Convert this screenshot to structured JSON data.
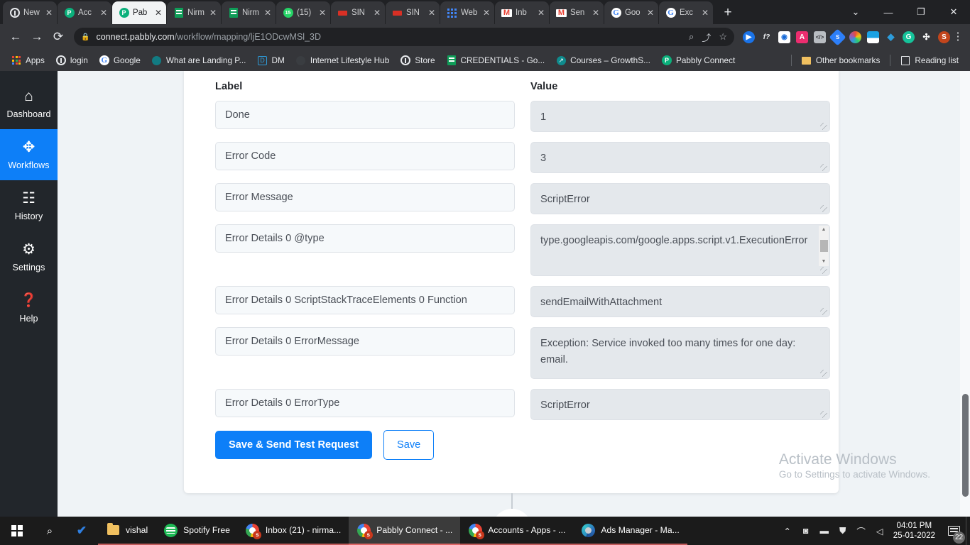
{
  "browser": {
    "tabs": [
      {
        "label": "New",
        "icon": "chrome-ring-icon",
        "active": false
      },
      {
        "label": "Acc",
        "icon": "pabbly-icon",
        "active": false
      },
      {
        "label": "Pab",
        "icon": "pabbly-icon",
        "active": true
      },
      {
        "label": "Nirm",
        "icon": "sheets-icon",
        "active": false
      },
      {
        "label": "Nirm",
        "icon": "sheets-icon",
        "active": false
      },
      {
        "label": "(15)",
        "icon": "whatsapp-icon",
        "active": false
      },
      {
        "label": "SIN",
        "icon": "red-icon",
        "active": false
      },
      {
        "label": "SIN",
        "icon": "red-icon",
        "active": false
      },
      {
        "label": "Web",
        "icon": "grid-icon",
        "active": false
      },
      {
        "label": "Inb",
        "icon": "gmail-icon",
        "active": false
      },
      {
        "label": "Sen",
        "icon": "gmail-icon",
        "active": false
      },
      {
        "label": "Goo",
        "icon": "google-icon",
        "active": false
      },
      {
        "label": "Exc",
        "icon": "google-icon",
        "active": false
      }
    ],
    "new_tab_label": "+",
    "tab_close_label": "✕",
    "window_controls": {
      "minimize_tabs": "⌄",
      "minimize": "—",
      "maximize": "❐",
      "close": "✕"
    },
    "nav": {
      "back": "←",
      "forward": "→",
      "reload": "⟳"
    },
    "address": {
      "lock_icon": "lock-icon",
      "domain": "connect.pabbly.com",
      "path": "/workflow/mapping/ljE1ODcwMSl_3D",
      "full_url": "connect.pabbly.com/workflow/mapping/ljE1ODcwMSl_3D"
    },
    "omni_actions": [
      {
        "name": "zoom-icon",
        "glyph": "⌕"
      },
      {
        "name": "share-icon",
        "glyph": "⤴"
      },
      {
        "name": "bookmark-star-icon",
        "glyph": "☆"
      }
    ],
    "extensions": [
      {
        "name": "loom-extension-icon",
        "glyph": "▶",
        "color": "#1a73e8"
      },
      {
        "name": "fonts-extension-icon",
        "glyph": "f?",
        "color": "#35363a"
      },
      {
        "name": "screen-recorder-extension-icon",
        "glyph": "◉",
        "color": "#1669d6"
      },
      {
        "name": "adobe-extension-icon",
        "glyph": "A",
        "color": "#ec2d6f"
      },
      {
        "name": "code-extension-icon",
        "glyph": "</>",
        "color": "#b9bdc2"
      },
      {
        "name": "seo-extension-icon",
        "glyph": "S",
        "color": "#2d7ff9"
      },
      {
        "name": "color-picker-extension-icon",
        "glyph": "◕",
        "color": "#43b02a"
      },
      {
        "name": "screenshot-extension-icon",
        "glyph": "▤",
        "color": "#1ba1e2"
      },
      {
        "name": "gem-extension-icon",
        "glyph": "◆",
        "color": "#2d9cdb"
      },
      {
        "name": "grammarly-extension-icon",
        "glyph": "G",
        "color": "#15c39a"
      },
      {
        "name": "puzzle-extensions-icon",
        "glyph": "🧩",
        "color": "#35363a"
      },
      {
        "name": "profile-avatar",
        "glyph": "S",
        "color": "#c2451c"
      }
    ],
    "menu_icon": "⋮",
    "bookmarks": [
      {
        "label": "Apps",
        "icon": "apps-grid-icon"
      },
      {
        "label": "login",
        "icon": "chrome-ring-icon"
      },
      {
        "label": "Google",
        "icon": "google-icon"
      },
      {
        "label": "What are Landing P...",
        "icon": "teal-circle-icon"
      },
      {
        "label": "DM",
        "icon": "blue-d-icon"
      },
      {
        "label": "Internet Lifestyle Hub",
        "icon": "dark-circle-icon"
      },
      {
        "label": "Store",
        "icon": "chrome-ring-icon"
      },
      {
        "label": "CREDENTIALS - Go...",
        "icon": "sheets-icon"
      },
      {
        "label": "Courses – GrowthS...",
        "icon": "teal-arrow-icon"
      },
      {
        "label": "Pabbly Connect",
        "icon": "pabbly-icon"
      }
    ],
    "bookmarks_right": [
      {
        "label": "Other bookmarks",
        "icon": "folder-icon"
      },
      {
        "label": "Reading list",
        "icon": "reading-list-icon"
      }
    ]
  },
  "sidebar": {
    "items": [
      {
        "label": "Dashboard",
        "icon": "home-icon",
        "glyph": "⌂",
        "active": false
      },
      {
        "label": "Workflows",
        "icon": "workflow-icon",
        "glyph": "✥",
        "active": true
      },
      {
        "label": "History",
        "icon": "history-list-icon",
        "glyph": "☰",
        "active": false
      },
      {
        "label": "Settings",
        "icon": "gear-icon",
        "glyph": "⚙",
        "active": false
      },
      {
        "label": "Help",
        "icon": "help-circle-icon",
        "glyph": "?",
        "active": false
      }
    ]
  },
  "main": {
    "columns": {
      "label": "Label",
      "value": "Value"
    },
    "rows": [
      {
        "label": "Done",
        "value": "1",
        "size": "h1",
        "scroll": false
      },
      {
        "label": "Error Code",
        "value": "3",
        "size": "h1",
        "scroll": false
      },
      {
        "label": "Error Message",
        "value": "ScriptError",
        "size": "h1",
        "scroll": false
      },
      {
        "label": "Error Details 0 @type",
        "value": "type.googleapis.com/google.apps.script.v1.ExecutionError",
        "size": "h2",
        "scroll": true
      },
      {
        "label": "Error Details 0 ScriptStackTraceElements 0 Function",
        "value": "sendEmailWithAttachment",
        "size": "h1",
        "scroll": false
      },
      {
        "label": "Error Details 0 ErrorMessage",
        "value": "Exception: Service invoked too many times for one day: email.",
        "size": "h2",
        "scroll": false
      },
      {
        "label": "Error Details 0 ErrorType",
        "value": "ScriptError",
        "size": "h1",
        "scroll": false
      }
    ],
    "buttons": {
      "primary": "Save & Send Test Request",
      "secondary": "Save"
    },
    "accent_color": "#0d7ff8"
  },
  "watermark": {
    "title": "Activate Windows",
    "subtitle": "Go to Settings to activate Windows."
  },
  "taskbar": {
    "start_icon": "windows-start-icon",
    "search_icon": "search-icon",
    "pinned_icon": "todo-check-icon",
    "apps": [
      {
        "label": "vishal",
        "icon": "folder-icon",
        "state": "running"
      },
      {
        "label": "Spotify Free",
        "icon": "spotify-icon",
        "state": "running"
      },
      {
        "label": "Inbox (21) - nirma...",
        "icon": "chrome-icon",
        "state": "running",
        "badge": "s"
      },
      {
        "label": "Pabbly Connect - ...",
        "icon": "chrome-icon",
        "state": "focused",
        "badge": "s"
      },
      {
        "label": "Accounts - Apps - ...",
        "icon": "chrome-icon",
        "state": "running",
        "badge": "s"
      },
      {
        "label": "Ads Manager - Ma...",
        "icon": "edge-icon",
        "state": "running"
      }
    ],
    "tray": [
      {
        "name": "show-hidden-icons-chevron",
        "glyph": "⌃"
      },
      {
        "name": "webcam-icon",
        "glyph": "⌗"
      },
      {
        "name": "battery-icon",
        "glyph": "▭"
      },
      {
        "name": "security-shield-icon",
        "glyph": "🛡"
      },
      {
        "name": "wifi-icon",
        "glyph": "◜"
      },
      {
        "name": "volume-icon",
        "glyph": "🔊"
      }
    ],
    "clock": {
      "time": "04:01 PM",
      "date": "25-01-2022"
    },
    "notification_count": "22"
  }
}
